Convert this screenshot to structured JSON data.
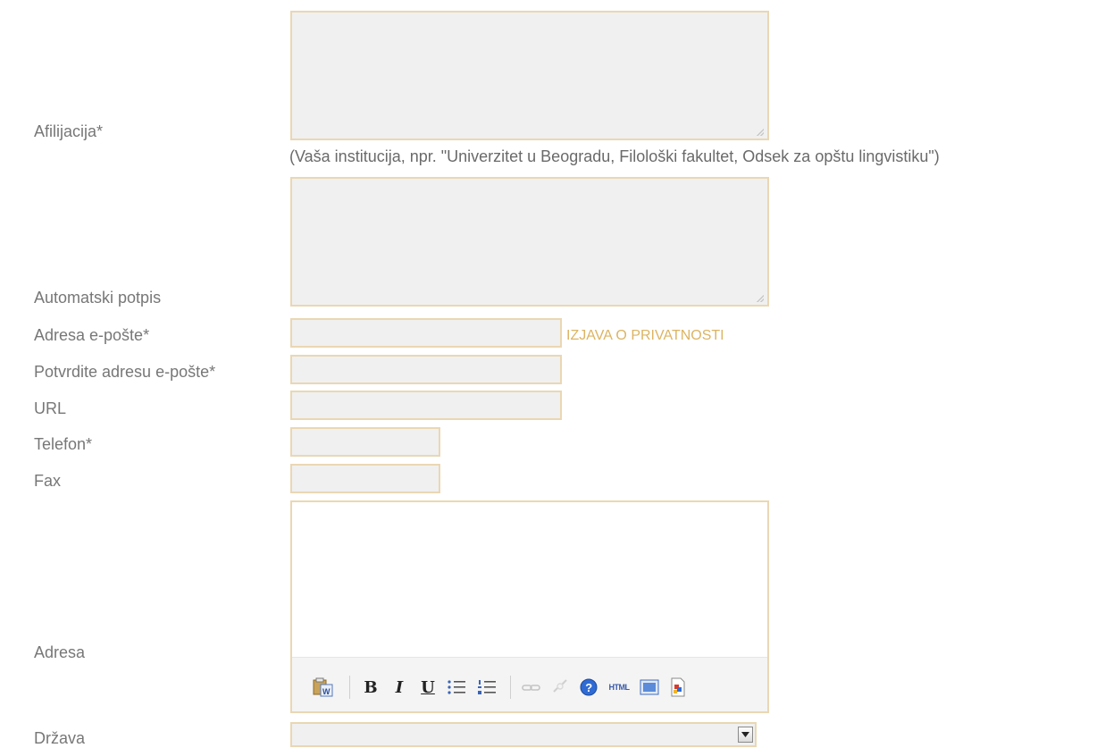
{
  "labels": {
    "affiliation": "Afilijacija*",
    "signature": "Automatski potpis",
    "email": "Adresa e-pošte*",
    "email_confirm": "Potvrdite adresu e-pošte*",
    "url": "URL",
    "phone": "Telefon*",
    "fax": "Fax",
    "address": "Adresa",
    "country": "Država"
  },
  "affiliation_hint": "(Vaša institucija, npr. \"Univerzitet u Beogradu, Filološki fakultet, Odsek za opštu lingvistiku\")",
  "privacy_link": "IZJAVA O PRIVATNOSTI",
  "toolbar": {
    "bold": "B",
    "italic": "I",
    "underline": "U",
    "html": "HTML"
  },
  "icons": [
    "paste-word-icon",
    "bold-icon",
    "italic-icon",
    "underline-icon",
    "bullet-list-icon",
    "numbered-list-icon",
    "link-icon",
    "unlink-icon",
    "help-icon",
    "html-icon",
    "fullscreen-icon",
    "image-icon"
  ],
  "colors": {
    "field_border": "#ead7b3",
    "link": "#dcb463",
    "field_bg": "#f0f0f0"
  }
}
